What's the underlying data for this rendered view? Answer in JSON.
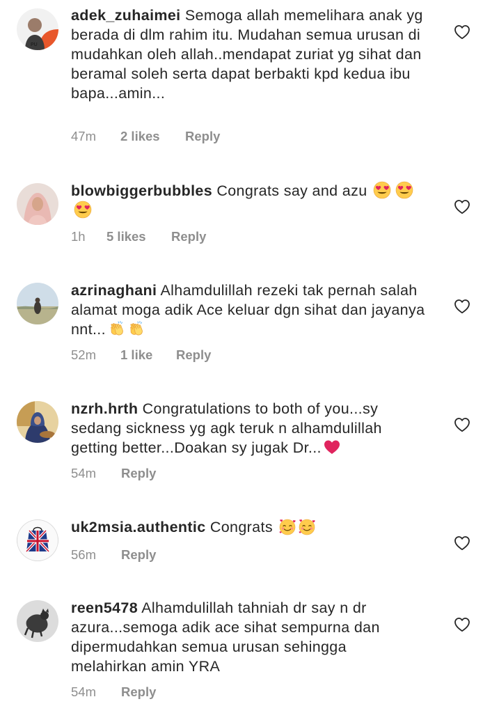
{
  "comments": [
    {
      "username": "adek_zuhaimei",
      "text": "Semoga allah memelihara anak yg berada di dlm rahim itu. Mudahan semua urusan di mudahkan oleh allah..mendapat zuriat yg sihat dan beramal soleh serta dapat berbakti kpd kedua ibu bapa...amin...",
      "time": "47m",
      "likes": "2 likes",
      "reply": "Reply"
    },
    {
      "username": "blowbiggerbubbles",
      "text": "Congrats say and azu",
      "emojis": [
        "heart-eyes-emoji",
        "heart-eyes-emoji",
        "heart-eyes-emoji"
      ],
      "time": "1h",
      "likes": "5 likes",
      "reply": "Reply"
    },
    {
      "username": "azrinaghani",
      "text": "Alhamdulillah rezeki tak pernah salah alamat moga adik Ace keluar dgn sihat dan jayanya nnt...",
      "emojis": [
        "clapping-hands-emoji",
        "clapping-hands-emoji"
      ],
      "time": "52m",
      "likes": "1 like",
      "reply": "Reply"
    },
    {
      "username": "nzrh.hrth",
      "text": "Congratulations to both of you...sy sedang sickness yg agk teruk n alhamdulillah getting better...Doakan sy jugak Dr...",
      "emojis": [
        "red-heart-emoji"
      ],
      "time": "54m",
      "reply": "Reply"
    },
    {
      "username": "uk2msia.authentic",
      "text": "Congrats",
      "emojis": [
        "smiling-face-with-hearts-emoji",
        "smiling-face-with-hearts-emoji"
      ],
      "time": "56m",
      "reply": "Reply"
    },
    {
      "username": "reen5478",
      "text": "Alhamdulillah tahniah dr say n dr azura...semoga adik ace sihat sempurna dan dipermudahkan semua urusan sehingga melahirkan amin YRA",
      "time": "54m",
      "reply": "Reply"
    }
  ],
  "colors": {
    "text": "#262626",
    "meta": "#8e8e8e",
    "heart_outline": "#262626"
  }
}
